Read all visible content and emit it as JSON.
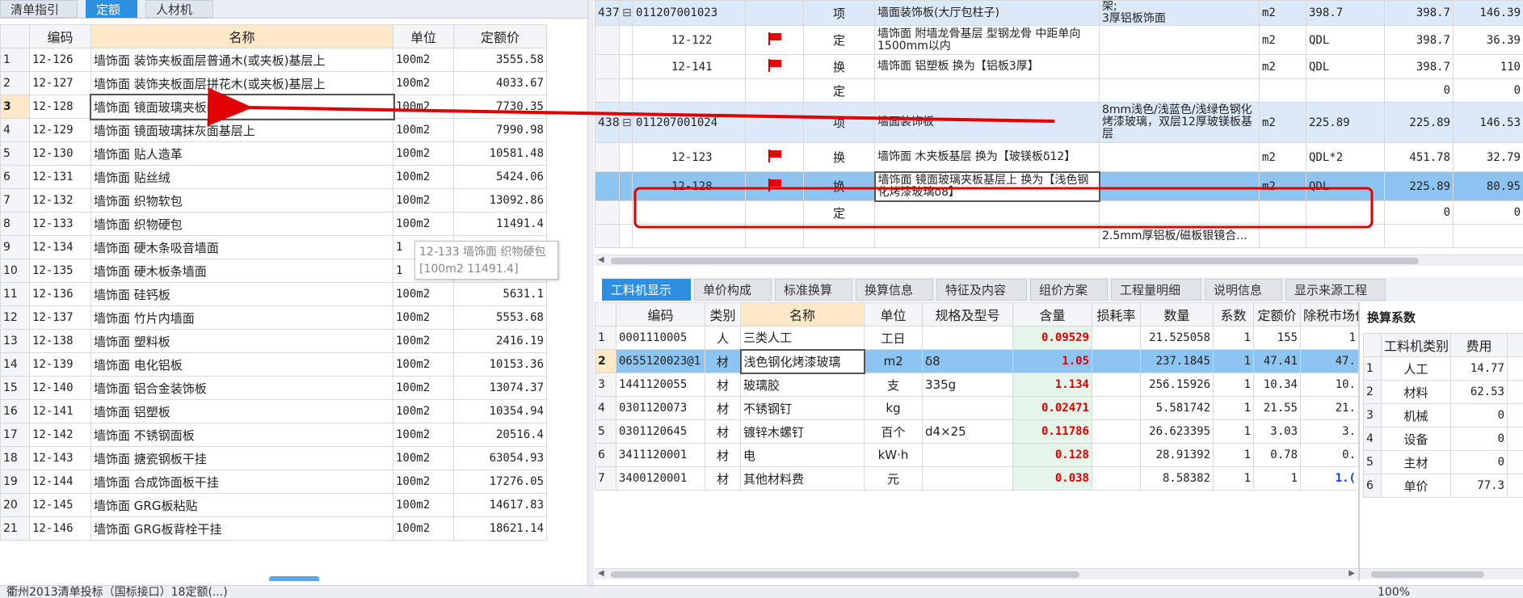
{
  "left_tabs": [
    "清单指引",
    "定额",
    "人材机"
  ],
  "quota_table": {
    "headers": [
      "编码",
      "名称",
      "单位",
      "定额价"
    ],
    "rows": [
      {
        "n": "1",
        "code": "12-126",
        "name": "墙饰面 装饰夹板面层普通木(或夹板)基层上",
        "unit": "100m2",
        "price": "3555.58"
      },
      {
        "n": "2",
        "code": "12-127",
        "name": "墙饰面 装饰夹板面层拼花木(或夹板)基层上",
        "unit": "100m2",
        "price": "4033.67"
      },
      {
        "n": "3",
        "code": "12-128",
        "name": "墙饰面 镜面玻璃夹板基层上",
        "unit": "100m2",
        "price": "7730.35"
      },
      {
        "n": "4",
        "code": "12-129",
        "name": "墙饰面 镜面玻璃抹灰面基层上",
        "unit": "100m2",
        "price": "7990.98"
      },
      {
        "n": "5",
        "code": "12-130",
        "name": "墙饰面 贴人造革",
        "unit": "100m2",
        "price": "10581.48"
      },
      {
        "n": "6",
        "code": "12-131",
        "name": "墙饰面 贴丝绒",
        "unit": "100m2",
        "price": "5424.06"
      },
      {
        "n": "7",
        "code": "12-132",
        "name": "墙饰面 织物软包",
        "unit": "100m2",
        "price": "13092.86"
      },
      {
        "n": "8",
        "code": "12-133",
        "name": "墙饰面 织物硬包",
        "unit": "100m2",
        "price": "11491.4"
      },
      {
        "n": "9",
        "code": "12-134",
        "name": "墙饰面 硬木条吸音墙面",
        "unit": "1",
        "price": ""
      },
      {
        "n": "10",
        "code": "12-135",
        "name": "墙饰面 硬木板条墙面",
        "unit": "1",
        "price": ""
      },
      {
        "n": "11",
        "code": "12-136",
        "name": "墙饰面 硅钙板",
        "unit": "100m2",
        "price": "5631.1"
      },
      {
        "n": "12",
        "code": "12-137",
        "name": "墙饰面 竹片内墙面",
        "unit": "100m2",
        "price": "5553.68"
      },
      {
        "n": "13",
        "code": "12-138",
        "name": "墙饰面 塑料板",
        "unit": "100m2",
        "price": "2416.19"
      },
      {
        "n": "14",
        "code": "12-139",
        "name": "墙饰面 电化铝板",
        "unit": "100m2",
        "price": "10153.36"
      },
      {
        "n": "15",
        "code": "12-140",
        "name": "墙饰面 铝合金装饰板",
        "unit": "100m2",
        "price": "13074.37"
      },
      {
        "n": "16",
        "code": "12-141",
        "name": "墙饰面 铝塑板",
        "unit": "100m2",
        "price": "10354.94"
      },
      {
        "n": "17",
        "code": "12-142",
        "name": "墙饰面 不锈钢面板",
        "unit": "100m2",
        "price": "20516.4"
      },
      {
        "n": "18",
        "code": "12-143",
        "name": "墙饰面 搪瓷钢板干挂",
        "unit": "100m2",
        "price": "63054.93"
      },
      {
        "n": "19",
        "code": "12-144",
        "name": "墙饰面 合成饰面板干挂",
        "unit": "100m2",
        "price": "17276.05"
      },
      {
        "n": "20",
        "code": "12-145",
        "name": "墙饰面 GRG板粘贴",
        "unit": "100m2",
        "price": "14617.83"
      },
      {
        "n": "21",
        "code": "12-146",
        "name": "墙饰面 GRG板背栓干挂",
        "unit": "100m2",
        "price": "18621.14"
      }
    ]
  },
  "tooltip": {
    "line1": "12-133 墙饰面 织物硬包",
    "line2": "[100m2 11491.4]"
  },
  "top_table": {
    "rows": [
      {
        "seq": "437",
        "code": "011207001023",
        "type": "项",
        "name": "墙面装饰板(大厅包柱子)",
        "feature": "架;\n3厚铝板饰面",
        "unit": "m2",
        "expr": "398.7",
        "qty": "398.7",
        "price": "146.39"
      },
      {
        "seq": "",
        "code": "12-122",
        "type": "定",
        "name": "墙饰面 附墙龙骨基层 型钢龙骨 中距单向1500mm以内",
        "feature": "",
        "unit": "m2",
        "expr": "QDL",
        "qty": "398.7",
        "price": "36.39"
      },
      {
        "seq": "",
        "code": "12-141",
        "type": "换",
        "name": "墙饰面 铝塑板  换为【铝板3厚】",
        "feature": "",
        "unit": "m2",
        "expr": "QDL",
        "qty": "398.7",
        "price": "110"
      },
      {
        "seq": "",
        "code": "",
        "type": "定",
        "name": "",
        "feature": "",
        "unit": "",
        "expr": "",
        "qty": "0",
        "price": "0"
      },
      {
        "seq": "438",
        "code": "011207001024",
        "type": "项",
        "name": "墙面装饰板",
        "feature": "8mm浅色/浅蓝色/浅绿色钢化烤漆玻璃，双层12厚玻镁板基层",
        "unit": "m2",
        "expr": "225.89",
        "qty": "225.89",
        "price": "146.53"
      },
      {
        "seq": "",
        "code": "12-123",
        "type": "换",
        "name": "墙饰面 木夹板基层  换为【玻镁板δ12】",
        "feature": "",
        "unit": "m2",
        "expr": "QDL*2",
        "qty": "451.78",
        "price": "32.79"
      },
      {
        "seq": "",
        "code": "12-128",
        "type": "换",
        "name": "墙饰面 镜面玻璃夹板基层上  换为【浅色钢化烤漆玻璃δ8】",
        "feature": "",
        "unit": "m2",
        "expr": "QDL",
        "qty": "225.89",
        "price": "80.95"
      },
      {
        "seq": "",
        "code": "",
        "type": "定",
        "name": "",
        "feature": "",
        "unit": "",
        "expr": "",
        "qty": "0",
        "price": "0"
      },
      {
        "seq": "",
        "code": "",
        "type": "",
        "name": "",
        "feature": "2.5mm厚铝板/磁板银镜合...",
        "unit": "",
        "expr": "",
        "qty": "",
        "price": ""
      }
    ]
  },
  "bottom_tabs": [
    "工料机显示",
    "单价构成",
    "标准换算",
    "换算信息",
    "特征及内容",
    "组价方案",
    "工程量明细",
    "说明信息",
    "显示来源工程"
  ],
  "material_table": {
    "headers": [
      "编码",
      "类别",
      "名称",
      "单位",
      "规格及型号",
      "含量",
      "损耗率",
      "数量",
      "系数",
      "定额价",
      "除税市场价"
    ],
    "rows": [
      {
        "n": "1",
        "code": "0001110005",
        "cat": "人",
        "name": "三类人工",
        "unit": "工日",
        "spec": "",
        "content": "0.09529",
        "loss": "",
        "qty": "21.525058",
        "coef": "1",
        "price": "155",
        "mkt": "1"
      },
      {
        "n": "2",
        "code": "0655120023@1",
        "cat": "材",
        "name": "浅色钢化烤漆玻璃",
        "unit": "m2",
        "spec": "δ8",
        "content": "1.05",
        "loss": "",
        "qty": "237.1845",
        "coef": "1",
        "price": "47.41",
        "mkt": "47."
      },
      {
        "n": "3",
        "code": "1441120055",
        "cat": "材",
        "name": "玻璃胶",
        "unit": "支",
        "spec": "335g",
        "content": "1.134",
        "loss": "",
        "qty": "256.15926",
        "coef": "1",
        "price": "10.34",
        "mkt": "10."
      },
      {
        "n": "4",
        "code": "0301120073",
        "cat": "材",
        "name": "不锈钢钉",
        "unit": "kg",
        "spec": "",
        "content": "0.02471",
        "loss": "",
        "qty": "5.581742",
        "coef": "1",
        "price": "21.55",
        "mkt": "21."
      },
      {
        "n": "5",
        "code": "0301120645",
        "cat": "材",
        "name": "镀锌木螺钉",
        "unit": "百个",
        "spec": "d4×25",
        "content": "0.11786",
        "loss": "",
        "qty": "26.623395",
        "coef": "1",
        "price": "3.03",
        "mkt": "3."
      },
      {
        "n": "6",
        "code": "3411120001",
        "cat": "材",
        "name": "电",
        "unit": "kW·h",
        "spec": "",
        "content": "0.128",
        "loss": "",
        "qty": "28.91392",
        "coef": "1",
        "price": "0.78",
        "mkt": "0."
      },
      {
        "n": "7",
        "code": "3400120001",
        "cat": "材",
        "name": "其他材料费",
        "unit": "元",
        "spec": "",
        "content": "0.038",
        "loss": "",
        "qty": "8.58382",
        "coef": "1",
        "price": "1",
        "mkt": "1.("
      }
    ]
  },
  "coef_panel": {
    "title": "换算系数",
    "headers": [
      "工料机类别",
      "费用"
    ],
    "rows": [
      {
        "n": "1",
        "cat": "人工",
        "fee": "14.77"
      },
      {
        "n": "2",
        "cat": "材料",
        "fee": "62.53"
      },
      {
        "n": "3",
        "cat": "机械",
        "fee": "0"
      },
      {
        "n": "4",
        "cat": "设备",
        "fee": "0"
      },
      {
        "n": "5",
        "cat": "主材",
        "fee": "0"
      },
      {
        "n": "6",
        "cat": "单价",
        "fee": "77.3"
      }
    ]
  },
  "status": {
    "project": "衢州2013清单投标（国标接口）18定额(...)",
    "zoom": "100%"
  },
  "colors": {
    "accent": "#2e8fe0",
    "selected_row": "#8cc4f2",
    "parent_row": "#dbe9f9",
    "red": "#e00000"
  }
}
